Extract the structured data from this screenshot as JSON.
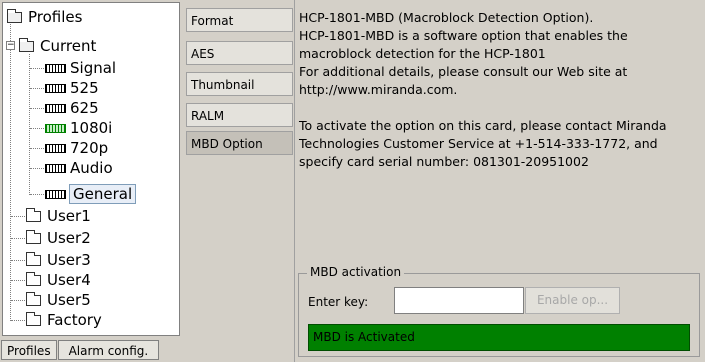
{
  "tree": {
    "root": "Profiles",
    "current": "Current",
    "current_children": [
      "Signal",
      "525",
      "625",
      "1080i",
      "720p",
      "Audio",
      "General"
    ],
    "users": [
      "User1",
      "User2",
      "User3",
      "User4",
      "User5",
      "Factory"
    ]
  },
  "bottom_tabs": [
    "Profiles",
    "Alarm config."
  ],
  "option_tabs": [
    "Format",
    "AES",
    "Thumbnail",
    "RALM",
    "MBD Option"
  ],
  "active_option_tab": "MBD Option",
  "description": {
    "lines": [
      "HCP-1801-MBD (Macroblock Detection Option).",
      "HCP-1801-MBD is a software option that enables the",
      "macroblock detection for the HCP-1801",
      "For additional details, please consult our Web site at",
      "http://www.miranda.com.",
      "",
      "To activate the option on this card, please contact Miranda",
      "Technologies Customer Service at +1-514-333-1772, and",
      "specify card serial number: 081301-20951002"
    ]
  },
  "activation": {
    "group_title": "MBD activation",
    "key_label": "Enter key:",
    "key_value": "",
    "enable_button": "Enable op...",
    "status_text": "MBD is Activated",
    "status_color": "#008000"
  }
}
